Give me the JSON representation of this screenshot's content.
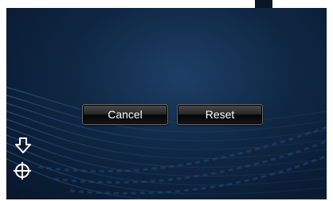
{
  "dialog": {
    "cancel_label": "Cancel",
    "reset_label": "Reset"
  },
  "icons": {
    "scroll_down": "arrow-down-icon",
    "target": "crosshair-icon"
  },
  "colors": {
    "background_dark": "#08162a",
    "background_mid": "#1d3f66",
    "button_text": "#ffffff"
  }
}
